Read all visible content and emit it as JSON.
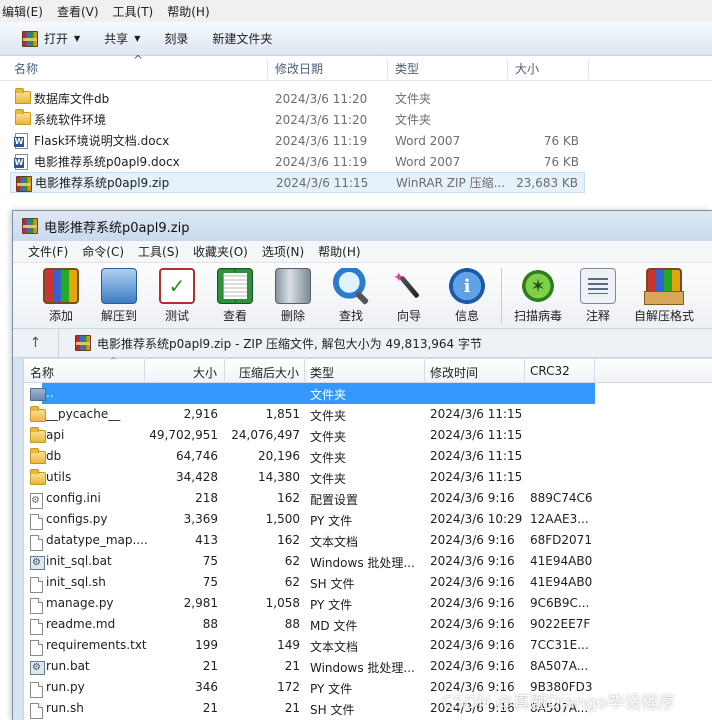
{
  "explorer": {
    "menu": [
      "编辑(E)",
      "查看(V)",
      "工具(T)",
      "帮助(H)"
    ],
    "toolbar": {
      "open": "打开",
      "share": "共享",
      "burn": "刻录",
      "new_folder": "新建文件夹"
    },
    "columns": {
      "name": "名称",
      "date": "修改日期",
      "type": "类型",
      "size": "大小"
    },
    "rows": [
      {
        "name": "数据库文件db",
        "date": "2024/3/6 11:20",
        "type": "文件夹",
        "size": "",
        "icon": "folder-icon"
      },
      {
        "name": "系统软件环境",
        "date": "2024/3/6 11:20",
        "type": "文件夹",
        "size": "",
        "icon": "folder-icon"
      },
      {
        "name": "Flask环境说明文档.docx",
        "date": "2024/3/6 11:19",
        "type": "Word 2007",
        "size": "76 KB",
        "icon": "word-doc-icon"
      },
      {
        "name": "电影推荐系统p0apl9.docx",
        "date": "2024/3/6 11:19",
        "type": "Word 2007",
        "size": "76 KB",
        "icon": "word-doc-icon"
      },
      {
        "name": "电影推荐系统p0apl9.zip",
        "date": "2024/3/6 11:15",
        "type": "WinRAR ZIP 压缩...",
        "size": "23,683 KB",
        "icon": "winrar-archive-icon"
      }
    ]
  },
  "winrar": {
    "title": "电影推荐系统p0apl9.zip",
    "menu": [
      "文件(F)",
      "命令(C)",
      "工具(S)",
      "收藏夹(O)",
      "选项(N)",
      "帮助(H)"
    ],
    "tools": [
      {
        "label": "添加",
        "icon": "add-icon"
      },
      {
        "label": "解压到",
        "icon": "extract-icon"
      },
      {
        "label": "测试",
        "icon": "test-icon"
      },
      {
        "label": "查看",
        "icon": "view-icon"
      },
      {
        "label": "删除",
        "icon": "delete-icon"
      },
      {
        "label": "查找",
        "icon": "find-icon"
      },
      {
        "label": "向导",
        "icon": "wizard-icon"
      },
      {
        "label": "信息",
        "icon": "info-icon"
      },
      {
        "label": "扫描病毒",
        "icon": "virus-scan-icon"
      },
      {
        "label": "注释",
        "icon": "comment-icon"
      },
      {
        "label": "自解压格式",
        "icon": "sfx-icon"
      }
    ],
    "path": "电影推荐系统p0apl9.zip - ZIP 压缩文件, 解包大小为 49,813,964 字节",
    "columns": {
      "name": "名称",
      "size": "大小",
      "packed": "压缩后大小",
      "type": "类型",
      "modified": "修改时间",
      "crc": "CRC32"
    },
    "rows": [
      {
        "name": "..",
        "size": "",
        "packed": "",
        "type": "文件夹",
        "modified": "",
        "crc": "",
        "icon": "parent-folder-icon",
        "selected": true
      },
      {
        "name": "__pycache__",
        "size": "2,916",
        "packed": "1,851",
        "type": "文件夹",
        "modified": "2024/3/6 11:15",
        "crc": "",
        "icon": "folder-icon"
      },
      {
        "name": "api",
        "size": "49,702,951",
        "packed": "24,076,497",
        "type": "文件夹",
        "modified": "2024/3/6 11:15",
        "crc": "",
        "icon": "folder-icon"
      },
      {
        "name": "db",
        "size": "64,746",
        "packed": "20,196",
        "type": "文件夹",
        "modified": "2024/3/6 11:15",
        "crc": "",
        "icon": "folder-icon"
      },
      {
        "name": "utils",
        "size": "34,428",
        "packed": "14,380",
        "type": "文件夹",
        "modified": "2024/3/6 11:15",
        "crc": "",
        "icon": "folder-icon"
      },
      {
        "name": "config.ini",
        "size": "218",
        "packed": "162",
        "type": "配置设置",
        "modified": "2024/3/6 9:16",
        "crc": "889C74C6",
        "icon": "config-file-icon"
      },
      {
        "name": "configs.py",
        "size": "3,369",
        "packed": "1,500",
        "type": "PY 文件",
        "modified": "2024/3/6 10:29",
        "crc": "12AAE3...",
        "icon": "file-icon"
      },
      {
        "name": "datatype_map....",
        "size": "413",
        "packed": "162",
        "type": "文本文档",
        "modified": "2024/3/6 9:16",
        "crc": "68FD2071",
        "icon": "file-icon"
      },
      {
        "name": "init_sql.bat",
        "size": "75",
        "packed": "62",
        "type": "Windows 批处理...",
        "modified": "2024/3/6 9:16",
        "crc": "41E94AB0",
        "icon": "batch-file-icon"
      },
      {
        "name": "init_sql.sh",
        "size": "75",
        "packed": "62",
        "type": "SH 文件",
        "modified": "2024/3/6 9:16",
        "crc": "41E94AB0",
        "icon": "file-icon"
      },
      {
        "name": "manage.py",
        "size": "2,981",
        "packed": "1,058",
        "type": "PY 文件",
        "modified": "2024/3/6 9:16",
        "crc": "9C6B9C...",
        "icon": "file-icon"
      },
      {
        "name": "readme.md",
        "size": "88",
        "packed": "88",
        "type": "MD 文件",
        "modified": "2024/3/6 9:16",
        "crc": "9022EE7F",
        "icon": "file-icon"
      },
      {
        "name": "requirements.txt",
        "size": "199",
        "packed": "149",
        "type": "文本文档",
        "modified": "2024/3/6 9:16",
        "crc": "7CC31E...",
        "icon": "file-icon"
      },
      {
        "name": "run.bat",
        "size": "21",
        "packed": "21",
        "type": "Windows 批处理...",
        "modified": "2024/3/6 9:16",
        "crc": "8A507A...",
        "icon": "batch-file-icon"
      },
      {
        "name": "run.py",
        "size": "346",
        "packed": "172",
        "type": "PY 文件",
        "modified": "2024/3/6 9:16",
        "crc": "9B380FD3",
        "icon": "file-icon"
      },
      {
        "name": "run.sh",
        "size": "21",
        "packed": "21",
        "type": "SH 文件",
        "modified": "2024/3/6 9:16",
        "crc": "8A507A...",
        "icon": "file-icon"
      }
    ]
  },
  "watermark": "CSDN @真题Django毕设程序"
}
